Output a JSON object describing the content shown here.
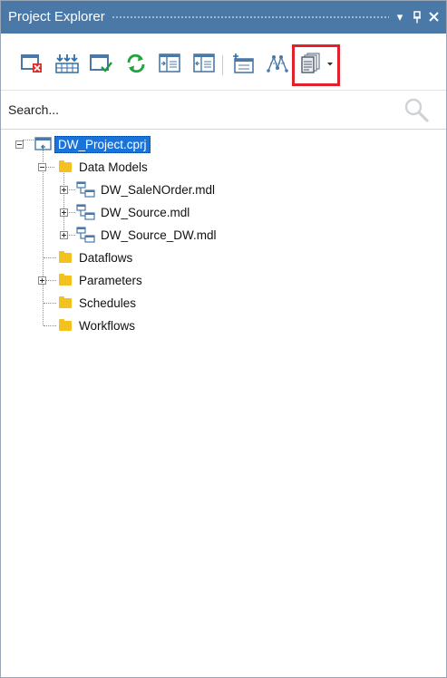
{
  "panel": {
    "title": "Project Explorer",
    "dropdown_glyph": "▾",
    "pin_glyph": "⫐",
    "close_glyph": "✕"
  },
  "toolbar": {
    "buttons": [
      {
        "name": "remove-icon"
      },
      {
        "name": "import-icon"
      },
      {
        "name": "check-window-icon"
      },
      {
        "name": "refresh-icon"
      },
      {
        "name": "expand-panel-icon"
      },
      {
        "name": "collapse-panel-icon"
      },
      {
        "name": "add-table-icon"
      },
      {
        "name": "diagram-icon"
      },
      {
        "name": "documents-dropdown-icon"
      }
    ],
    "highlighted": "documents-dropdown-icon",
    "highlight_color": "#e0202a"
  },
  "search": {
    "placeholder": "Search..."
  },
  "tree": {
    "root": "DW_Project.cprj",
    "data_models": "Data Models",
    "model_1": "DW_SaleNOrder.mdl",
    "model_2": "DW_Source.mdl",
    "model_3": "DW_Source_DW.mdl",
    "dataflows": "Dataflows",
    "parameters": "Parameters",
    "schedules": "Schedules",
    "workflows": "Workflows"
  },
  "colors": {
    "titlebar": "#4a79a8",
    "selection": "#1a73d9",
    "folder": "#f4c21f"
  }
}
